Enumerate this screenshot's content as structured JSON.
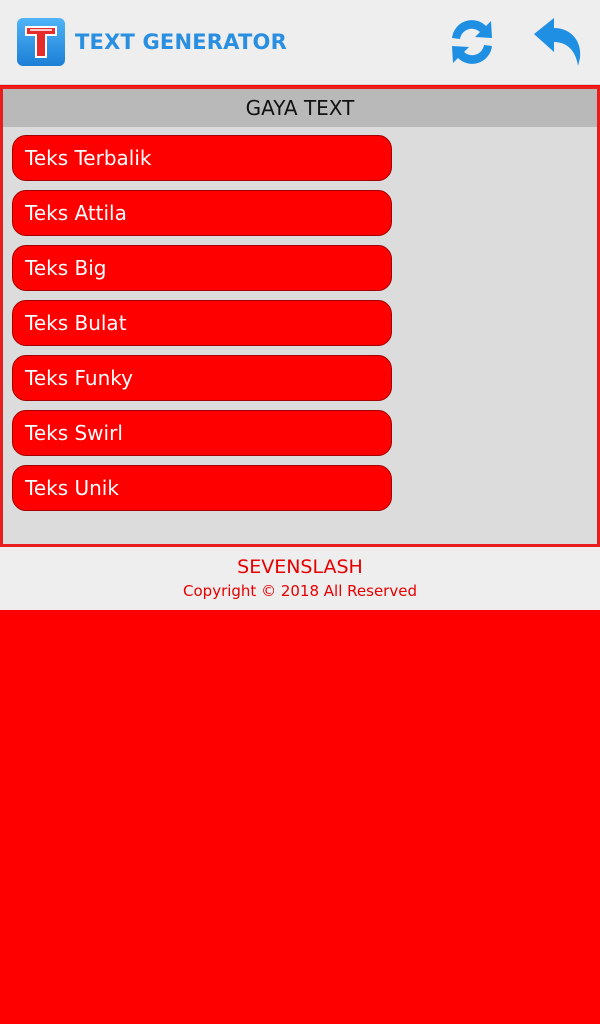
{
  "header": {
    "title": "TEXT GENERATOR",
    "logo_icon": "text-generator-logo-icon",
    "refresh_icon": "refresh-icon",
    "undo_icon": "undo-icon"
  },
  "panel": {
    "heading": "GAYA TEXT",
    "styles": [
      {
        "label": "Teks Terbalik"
      },
      {
        "label": "Teks Attila"
      },
      {
        "label": "Teks Big"
      },
      {
        "label": "Teks Bulat"
      },
      {
        "label": "Teks Funky"
      },
      {
        "label": "Teks Swirl"
      },
      {
        "label": "Teks Unik"
      }
    ]
  },
  "footer": {
    "brand": "SEVENSLASH",
    "copyright": "Copyright © 2018 All Reserved"
  },
  "colors": {
    "accent_red": "#ff0000",
    "title_blue": "#2a8fe0",
    "panel_bg": "#dcdcdc",
    "header_bg": "#eeeeee"
  }
}
